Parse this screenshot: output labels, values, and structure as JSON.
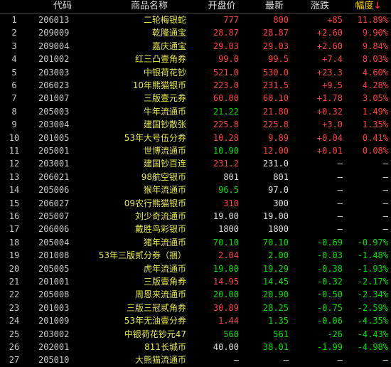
{
  "headers": {
    "code": "代码",
    "name": "商品名称",
    "open": "开盘价",
    "last": "最新",
    "change": "涨跌",
    "pct": "幅度",
    "sort_arrow": "↓"
  },
  "colors": {
    "up": "#ff4040",
    "down": "#00e000",
    "flat": "#e0e0e0",
    "index": "#c8c8c8",
    "code": "#c8c8c8",
    "name": "#e8e850",
    "dash": "#e0e0e0"
  },
  "rows": [
    {
      "idx": "1",
      "code": "206013",
      "name": "二轮梅银蛇",
      "open": "777",
      "open_c": "up",
      "last": "800",
      "last_c": "up",
      "chg": "+85",
      "chg_c": "up",
      "pct": "11.89%",
      "pct_c": "up"
    },
    {
      "idx": "2",
      "code": "209009",
      "name": "乾隆通宝",
      "open": "28.87",
      "open_c": "up",
      "last": "28.87",
      "last_c": "up",
      "chg": "+2.60",
      "chg_c": "up",
      "pct": "9.90%",
      "pct_c": "up"
    },
    {
      "idx": "3",
      "code": "209004",
      "name": "嘉庆通宝",
      "open": "29.03",
      "open_c": "up",
      "last": "29.03",
      "last_c": "up",
      "chg": "+2.60",
      "chg_c": "up",
      "pct": "9.84%",
      "pct_c": "up"
    },
    {
      "idx": "4",
      "code": "201002",
      "name": "红三凸壹角券",
      "open": "99.0",
      "open_c": "up",
      "last": "99.5",
      "last_c": "up",
      "chg": "+7.4",
      "chg_c": "up",
      "pct": "8.03%",
      "pct_c": "up"
    },
    {
      "idx": "5",
      "code": "203003",
      "name": "中银荷花钞",
      "open": "521.0",
      "open_c": "up",
      "last": "530.0",
      "last_c": "up",
      "chg": "+23.3",
      "chg_c": "up",
      "pct": "4.60%",
      "pct_c": "up"
    },
    {
      "idx": "6",
      "code": "206023",
      "name": "10年熊猫银币",
      "open": "223.0",
      "open_c": "up",
      "last": "231.5",
      "last_c": "up",
      "chg": "+9.5",
      "chg_c": "up",
      "pct": "4.28%",
      "pct_c": "up"
    },
    {
      "idx": "7",
      "code": "201007",
      "name": "三版壹元券",
      "open": "60.00",
      "open_c": "up",
      "last": "60.10",
      "last_c": "up",
      "chg": "+1.78",
      "chg_c": "up",
      "pct": "3.05%",
      "pct_c": "up"
    },
    {
      "idx": "8",
      "code": "205003",
      "name": "牛年流通币",
      "open": "21.22",
      "open_c": "down",
      "last": "21.80",
      "last_c": "up",
      "chg": "+0.32",
      "chg_c": "up",
      "pct": "1.49%",
      "pct_c": "up"
    },
    {
      "idx": "9",
      "code": "203004",
      "name": "建国钞散张",
      "open": "225.8",
      "open_c": "up",
      "last": "225.8",
      "last_c": "up",
      "chg": "+3.0",
      "chg_c": "up",
      "pct": "1.35%",
      "pct_c": "up"
    },
    {
      "idx": "10",
      "code": "201005",
      "name": "53年大号伍分券",
      "open": "10.28",
      "open_c": "up",
      "last": "9.89",
      "last_c": "up",
      "chg": "+0.04",
      "chg_c": "up",
      "pct": "0.41%",
      "pct_c": "up"
    },
    {
      "idx": "11",
      "code": "205001",
      "name": "世博流通币",
      "open": "10.90",
      "open_c": "down",
      "last": "12.00",
      "last_c": "up",
      "chg": "+0.01",
      "chg_c": "up",
      "pct": "0.08%",
      "pct_c": "up"
    },
    {
      "idx": "12",
      "code": "203001",
      "name": "建国钞百连",
      "open": "231.2",
      "open_c": "up",
      "last": "231.0",
      "last_c": "flat",
      "chg": "—",
      "chg_c": "flat",
      "pct": "—",
      "pct_c": "flat"
    },
    {
      "idx": "13",
      "code": "206021",
      "name": "98航空银币",
      "open": "801",
      "open_c": "flat",
      "last": "801",
      "last_c": "flat",
      "chg": "—",
      "chg_c": "flat",
      "pct": "—",
      "pct_c": "flat"
    },
    {
      "idx": "14",
      "code": "205006",
      "name": "猴年流通币",
      "open": "96.5",
      "open_c": "down",
      "last": "97.0",
      "last_c": "flat",
      "chg": "—",
      "chg_c": "flat",
      "pct": "—",
      "pct_c": "flat"
    },
    {
      "idx": "15",
      "code": "206027",
      "name": "09农行熊猫银币",
      "open": "310",
      "open_c": "up",
      "last": "300",
      "last_c": "flat",
      "chg": "—",
      "chg_c": "flat",
      "pct": "—",
      "pct_c": "flat"
    },
    {
      "idx": "16",
      "code": "205007",
      "name": "刘少奇流通币",
      "open": "19.00",
      "open_c": "flat",
      "last": "19.00",
      "last_c": "flat",
      "chg": "—",
      "chg_c": "flat",
      "pct": "—",
      "pct_c": "flat"
    },
    {
      "idx": "17",
      "code": "206006",
      "name": "戴胜鸟彩银币",
      "open": "1800",
      "open_c": "flat",
      "last": "1800",
      "last_c": "flat",
      "chg": "—",
      "chg_c": "flat",
      "pct": "—",
      "pct_c": "flat"
    },
    {
      "idx": "18",
      "code": "205004",
      "name": "猪年流通币",
      "open": "70.10",
      "open_c": "down",
      "last": "70.10",
      "last_c": "down",
      "chg": "-0.69",
      "chg_c": "down",
      "pct": "-0.97%",
      "pct_c": "down"
    },
    {
      "idx": "19",
      "code": "201008",
      "name": "53年三版贰分券（捆）",
      "open": "2.04",
      "open_c": "up",
      "last": "2.00",
      "last_c": "down",
      "chg": "-0.03",
      "chg_c": "down",
      "pct": "-1.48%",
      "pct_c": "down"
    },
    {
      "idx": "20",
      "code": "205005",
      "name": "虎年流通币",
      "open": "19.00",
      "open_c": "down",
      "last": "19.29",
      "last_c": "down",
      "chg": "-0.38",
      "chg_c": "down",
      "pct": "-1.93%",
      "pct_c": "down"
    },
    {
      "idx": "21",
      "code": "201001",
      "name": "三版壹角券",
      "open": "14.95",
      "open_c": "up",
      "last": "14.45",
      "last_c": "down",
      "chg": "-0.32",
      "chg_c": "down",
      "pct": "-2.17%",
      "pct_c": "down"
    },
    {
      "idx": "22",
      "code": "205008",
      "name": "周恩来流通币",
      "open": "20.00",
      "open_c": "down",
      "last": "20.90",
      "last_c": "down",
      "chg": "-0.50",
      "chg_c": "down",
      "pct": "-2.34%",
      "pct_c": "down"
    },
    {
      "idx": "23",
      "code": "201003",
      "name": "三版三冠贰角券",
      "open": "30.89",
      "open_c": "up",
      "last": "28.25",
      "last_c": "down",
      "chg": "-0.75",
      "chg_c": "down",
      "pct": "-2.59%",
      "pct_c": "down"
    },
    {
      "idx": "24",
      "code": "201009",
      "name": "53年无油壹分券",
      "open": "1.44",
      "open_c": "up",
      "last": "1.35",
      "last_c": "down",
      "chg": "-0.06",
      "chg_c": "down",
      "pct": "-4.35%",
      "pct_c": "down"
    },
    {
      "idx": "25",
      "code": "203002",
      "name": "中银荷花钞元47",
      "open": "560",
      "open_c": "down",
      "last": "561",
      "last_c": "down",
      "chg": "-26",
      "chg_c": "down",
      "pct": "-4.43%",
      "pct_c": "down"
    },
    {
      "idx": "26",
      "code": "202001",
      "name": "811长城币",
      "open": "40.00",
      "open_c": "flat",
      "last": "38.01",
      "last_c": "down",
      "chg": "-1.99",
      "chg_c": "down",
      "pct": "-4.98%",
      "pct_c": "down"
    },
    {
      "idx": "27",
      "code": "205010",
      "name": "大熊猫流通币",
      "open": "—",
      "open_c": "flat",
      "last": "—",
      "last_c": "flat",
      "chg": "—",
      "chg_c": "flat",
      "pct": "—",
      "pct_c": "flat"
    }
  ]
}
